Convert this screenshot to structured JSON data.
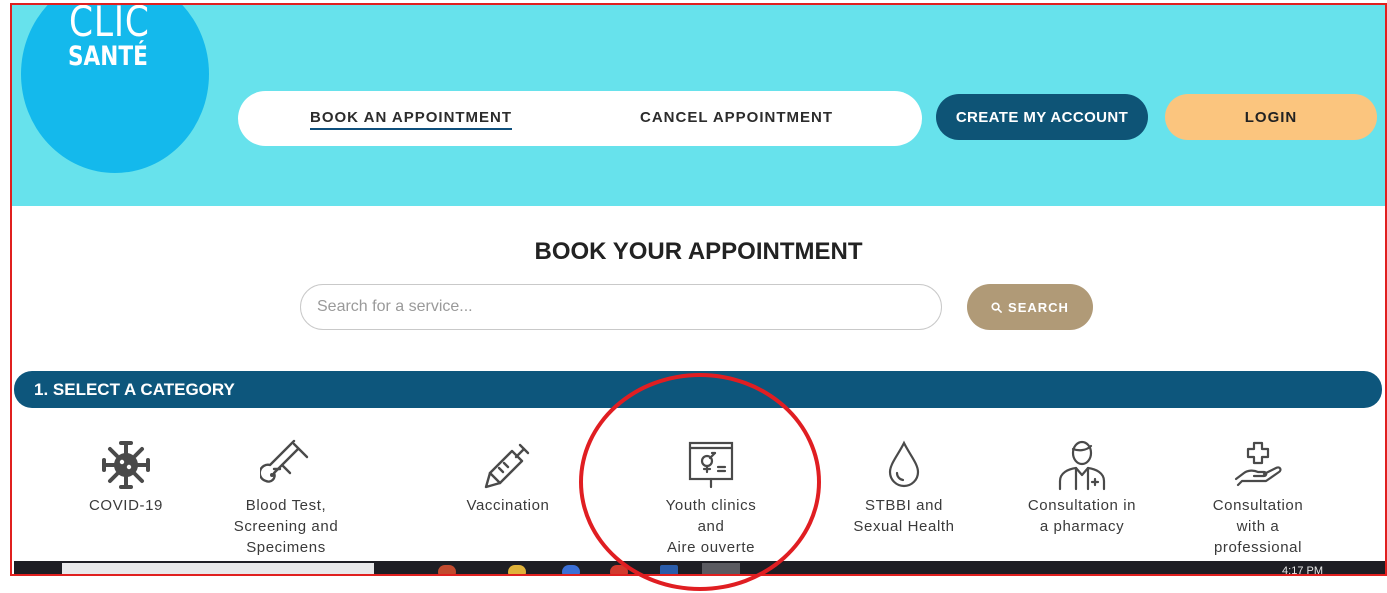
{
  "header": {
    "logo": {
      "line1": "CLIC",
      "line2": "SANTÉ"
    },
    "nav": {
      "book": "BOOK AN APPOINTMENT",
      "cancel": "CANCEL APPOINTMENT"
    },
    "create_account": "CREATE MY ACCOUNT",
    "login": "LOGIN"
  },
  "main": {
    "title": "BOOK YOUR APPOINTMENT",
    "search_placeholder": "Search for a service...",
    "search_button": "SEARCH",
    "section_title": "1. SELECT A CATEGORY"
  },
  "categories": [
    {
      "icon": "virus-icon",
      "line1": "COVID-19",
      "line2": "",
      "line3": ""
    },
    {
      "icon": "test-tube-icon",
      "line1": "Blood Test,",
      "line2": "Screening and",
      "line3": "Specimens"
    },
    {
      "icon": "syringe-icon",
      "line1": "Vaccination",
      "line2": "",
      "line3": ""
    },
    {
      "icon": "presentation-board-icon",
      "line1": "Youth clinics",
      "line2": "and",
      "line3": "Aire ouverte"
    },
    {
      "icon": "drop-icon",
      "line1": "STBBI and",
      "line2": "Sexual Health",
      "line3": ""
    },
    {
      "icon": "pharmacist-icon",
      "line1": "Consultation in",
      "line2": "a pharmacy",
      "line3": ""
    },
    {
      "icon": "hand-cross-icon",
      "line1": "Consultation",
      "line2": "with a",
      "line3": "professional"
    }
  ],
  "taskbar": {
    "time": "4:17 PM"
  },
  "colors": {
    "header_bg": "#67e2ec",
    "logo_circle": "#14b9ec",
    "primary_dark": "#0e5476",
    "login_bg": "#fbc57e",
    "search_bg": "#b09a77",
    "annotation": "#e01e22"
  }
}
